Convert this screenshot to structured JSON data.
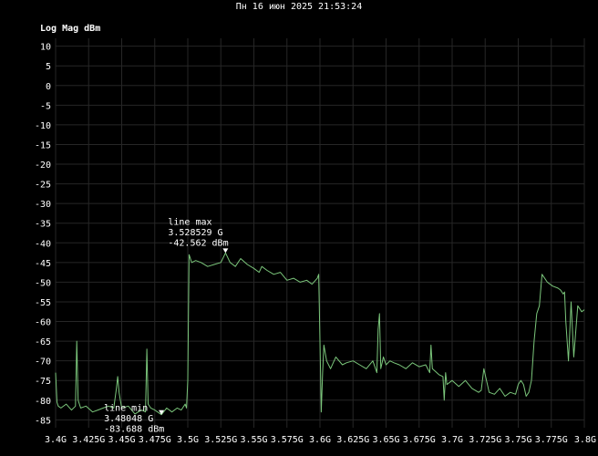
{
  "header": {
    "datetime": "Пн 16 июн 2025 21:53:24"
  },
  "chart_data": {
    "type": "line",
    "ylabel": "Log Mag dBm",
    "xlabel": "",
    "xlim": [
      3400000000,
      3800000000
    ],
    "ylim": [
      -87,
      12
    ],
    "grid": true,
    "y_ticks": [
      10,
      5,
      0,
      -5,
      -10,
      -15,
      -20,
      -25,
      -30,
      -35,
      -40,
      -45,
      -50,
      -55,
      -60,
      -65,
      -70,
      -75,
      -80,
      -85
    ],
    "x_ticks": [
      {
        "value": 3400000000,
        "label": "3.4G"
      },
      {
        "value": 3425000000,
        "label": "3.425G"
      },
      {
        "value": 3450000000,
        "label": "3.45G"
      },
      {
        "value": 3475000000,
        "label": "3.475G"
      },
      {
        "value": 3500000000,
        "label": "3.5G"
      },
      {
        "value": 3525000000,
        "label": "3.525G"
      },
      {
        "value": 3550000000,
        "label": "3.55G"
      },
      {
        "value": 3575000000,
        "label": "3.575G"
      },
      {
        "value": 3600000000,
        "label": "3.6G"
      },
      {
        "value": 3625000000,
        "label": "3.625G"
      },
      {
        "value": 3650000000,
        "label": "3.65G"
      },
      {
        "value": 3675000000,
        "label": "3.675G"
      },
      {
        "value": 3700000000,
        "label": "3.7G"
      },
      {
        "value": 3725000000,
        "label": "3.725G"
      },
      {
        "value": 3750000000,
        "label": "3.75G"
      },
      {
        "value": 3775000000,
        "label": "3.775G"
      },
      {
        "value": 3800000000,
        "label": "3.8G"
      }
    ],
    "series_color": "#7bc67b",
    "series": [
      {
        "x": [
          3400000000,
          3401000000,
          3402000000,
          3404000000,
          3408000000,
          3412000000,
          3415000000,
          3416000000,
          3417000000,
          3419000000,
          3423000000,
          3428000000,
          3432000000,
          3436000000,
          3440000000,
          3444000000,
          3446000000,
          3447000000,
          3448000000,
          3450000000,
          3455000000,
          3460000000,
          3465000000,
          3468000000,
          3469000000,
          3470000000,
          3472000000,
          3475000000,
          3480048000,
          3484000000,
          3488000000,
          3492000000,
          3495000000,
          3498000000,
          3499000000,
          3500000000,
          3501000000,
          3503000000,
          3506000000,
          3510000000,
          3515000000,
          3520000000,
          3525000000,
          3528529000,
          3532000000,
          3536000000,
          3540000000,
          3545000000,
          3550000000,
          3554000000,
          3556000000,
          3560000000,
          3565000000,
          3570000000,
          3575000000,
          3580000000,
          3585000000,
          3590000000,
          3594000000,
          3598000000,
          3599000000,
          3600000000,
          3601000000,
          3602000000,
          3603000000,
          3605000000,
          3608000000,
          3612000000,
          3617000000,
          3620000000,
          3625000000,
          3630000000,
          3635000000,
          3640000000,
          3643000000,
          3644000000,
          3645000000,
          3646000000,
          3648000000,
          3650000000,
          3653000000,
          3656000000,
          3660000000,
          3665000000,
          3670000000,
          3675000000,
          3680000000,
          3683000000,
          3684000000,
          3685000000,
          3690000000,
          3693000000,
          3694000000,
          3695000000,
          3696000000,
          3700000000,
          3705000000,
          3710000000,
          3715000000,
          3720000000,
          3722000000,
          3724000000,
          3728000000,
          3732000000,
          3736000000,
          3740000000,
          3744000000,
          3748000000,
          3750000000,
          3752000000,
          3754000000,
          3756000000,
          3758000000,
          3760000000,
          3762000000,
          3764000000,
          3766000000,
          3768000000,
          3772000000,
          3776000000,
          3780000000,
          3782000000,
          3784000000,
          3785000000,
          3786000000,
          3788000000,
          3790000000,
          3792000000,
          3795000000,
          3798000000,
          3800000000
        ],
        "y": [
          -73,
          -80.5,
          -81.5,
          -82,
          -81,
          -82.5,
          -81.5,
          -65,
          -80,
          -82,
          -81.5,
          -83,
          -82.5,
          -82,
          -81.5,
          -82,
          -77,
          -74,
          -78,
          -82,
          -81.5,
          -83.5,
          -82.5,
          -83,
          -67,
          -81,
          -82,
          -82.5,
          -83.688,
          -82,
          -83,
          -82,
          -82.5,
          -81,
          -82,
          -75,
          -43,
          -45,
          -44.5,
          -45,
          -46,
          -45.5,
          -45,
          -42.562,
          -45,
          -46,
          -44,
          -45.5,
          -46.5,
          -47.5,
          -46,
          -47,
          -48,
          -47.5,
          -49.5,
          -49,
          -50,
          -49.5,
          -50.5,
          -49,
          -48,
          -65,
          -83,
          -73,
          -66,
          -70,
          -72,
          -69,
          -71,
          -70.5,
          -70,
          -71,
          -72,
          -70,
          -73,
          -62,
          -58,
          -72,
          -69,
          -71,
          -70,
          -70.5,
          -71,
          -72,
          -70.5,
          -71.5,
          -71,
          -73,
          -66,
          -72,
          -73.5,
          -74,
          -80,
          -73,
          -76,
          -75,
          -76.5,
          -75,
          -77,
          -78,
          -77.5,
          -72,
          -78,
          -78.5,
          -77,
          -79,
          -78,
          -78.5,
          -76,
          -75,
          -76,
          -79,
          -78,
          -75,
          -65,
          -58,
          -56,
          -48,
          -50,
          -51,
          -51.5,
          -52,
          -53,
          -52.5,
          -60,
          -70,
          -55,
          -69,
          -56,
          -57.5,
          -57
        ]
      }
    ],
    "annotations": [
      {
        "text": [
          "line max",
          "3.528529 G",
          "-42.562 dBm"
        ],
        "x": 3528529000,
        "y": -42.562,
        "anchor": "above"
      },
      {
        "text": [
          "line min",
          "3.48048 G",
          "-83.688 dBm"
        ],
        "x": 3480048000,
        "y": -83.688,
        "anchor": "left"
      }
    ]
  }
}
